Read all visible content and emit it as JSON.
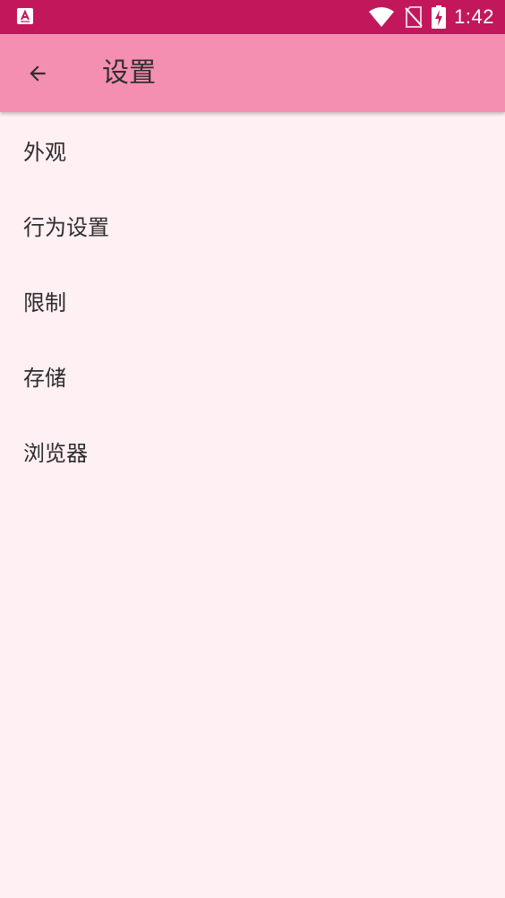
{
  "status_bar": {
    "time": "1:42",
    "icons": [
      "app-notification-icon",
      "wifi-icon",
      "no-sim-icon",
      "battery-charging-icon"
    ],
    "background_color": "#c2185b"
  },
  "app_bar": {
    "title": "设置",
    "back_icon": "arrow-back-icon",
    "background_color": "#f48fb1"
  },
  "settings": {
    "items": [
      {
        "label": "外观"
      },
      {
        "label": "行为设置"
      },
      {
        "label": "限制"
      },
      {
        "label": "存储"
      },
      {
        "label": "浏览器"
      }
    ]
  },
  "colors": {
    "page_background": "#fff0f4",
    "text": "#2d2d2d"
  }
}
